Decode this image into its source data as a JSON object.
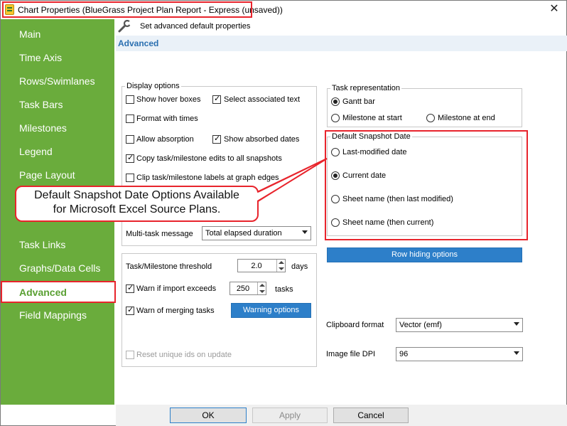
{
  "window": {
    "title": "Chart Properties (BlueGrass Project Plan Report - Express (unsaved))",
    "close_glyph": "✕"
  },
  "sidebar": {
    "items": [
      {
        "label": "Main"
      },
      {
        "label": "Time Axis"
      },
      {
        "label": "Rows/Swimlanes"
      },
      {
        "label": "Task Bars"
      },
      {
        "label": "Milestones"
      },
      {
        "label": "Legend"
      },
      {
        "label": "Page Layout"
      },
      {
        "label": "Task Links"
      },
      {
        "label": "Graphs/Data Cells"
      },
      {
        "label": "Advanced",
        "selected": true
      },
      {
        "label": "Field Mappings"
      }
    ]
  },
  "header": {
    "subtitle": "Set advanced default properties",
    "section_title": "Advanced",
    "icon": "wrench-icon"
  },
  "display_options": {
    "legend": "Display options",
    "show_hover_boxes": {
      "label": "Show hover boxes",
      "checked": false
    },
    "select_associated_text": {
      "label": "Select associated text",
      "checked": true
    },
    "format_with_times": {
      "label": "Format with times",
      "checked": false
    },
    "allow_absorption": {
      "label": "Allow absorption",
      "checked": false
    },
    "show_absorbed_dates": {
      "label": "Show absorbed dates",
      "checked": true
    },
    "copy_edits": {
      "label": "Copy task/milestone edits to all snapshots",
      "checked": true
    },
    "clip_labels": {
      "label": "Clip task/milestone labels at graph edges",
      "checked": false
    },
    "multi_task_message": {
      "label": "Multi-task message",
      "value": "Total elapsed duration"
    }
  },
  "thresholds": {
    "threshold_label": "Task/Milestone threshold",
    "threshold_value": "2.0",
    "threshold_unit": "days",
    "warn_import": {
      "label": "Warn if import exceeds",
      "checked": true
    },
    "import_value": "250",
    "import_unit": "tasks",
    "warn_merging": {
      "label": "Warn of merging tasks",
      "checked": true
    },
    "warning_options_button": "Warning options",
    "reset_ids": {
      "label": "Reset unique ids on update",
      "checked": false,
      "disabled": true
    }
  },
  "task_representation": {
    "legend": "Task representation",
    "gantt_bar": {
      "label": "Gantt bar",
      "selected": true
    },
    "milestone_at_start": {
      "label": "Milestone at start",
      "selected": false
    },
    "milestone_at_end": {
      "label": "Milestone at end",
      "selected": false
    }
  },
  "snapshot_date": {
    "legend": "Default Snapshot Date",
    "options": [
      {
        "label": "Last-modified date",
        "selected": false
      },
      {
        "label": "Current date",
        "selected": true
      },
      {
        "label": "Sheet name (then last modified)",
        "selected": false
      },
      {
        "label": "Sheet name (then current)",
        "selected": false
      }
    ]
  },
  "row_hiding_button": "Row hiding options",
  "clipboard": {
    "label": "Clipboard format",
    "value": "Vector (emf)"
  },
  "image_dpi": {
    "label": "Image file DPI",
    "value": "96"
  },
  "callout": {
    "line1": "Default Snapshot Date Options Available",
    "line2": "for Microsoft Excel Source Plans."
  },
  "footer": {
    "ok": "OK",
    "apply": "Apply",
    "cancel": "Cancel"
  },
  "colors": {
    "sidebar": "#6aac3c",
    "accent_blue": "#2d7fc9",
    "highlight_red": "#e8242c"
  }
}
